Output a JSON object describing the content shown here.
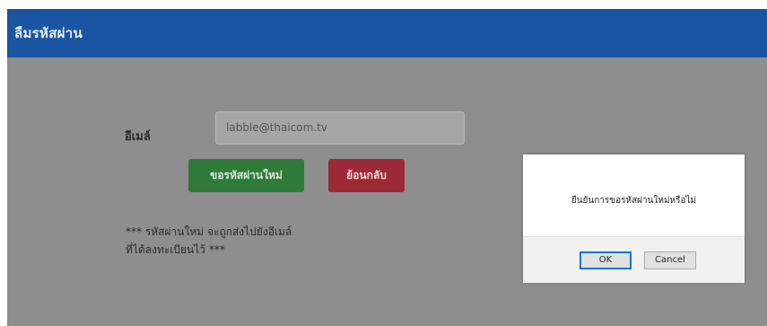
{
  "window": {
    "title": "ลืมรหัสผ่าน"
  },
  "form": {
    "email_label": "อีเมล์",
    "email_value": "labble@thaicom.tv",
    "request_button": "ขอรหัสผ่านใหม่",
    "back_button": "ย้อนกลับ",
    "note_line1": "*** รหัสผ่านใหม่ จะถูกส่งไปยังอีเมล์",
    "note_line2": "ที่ได้ลงทะเบียนไว้ ***"
  },
  "dialog": {
    "message": "ยืนยันการขอรหัสผ่านใหม่หรือไม่",
    "ok_label": "OK",
    "cancel_label": "Cancel"
  },
  "colors": {
    "titlebar": "#1a55a3",
    "overlay_bg": "#8e8e8e",
    "request_button": "#2f7a3a",
    "back_button": "#9b2a36",
    "focus_border": "#0078d7"
  }
}
